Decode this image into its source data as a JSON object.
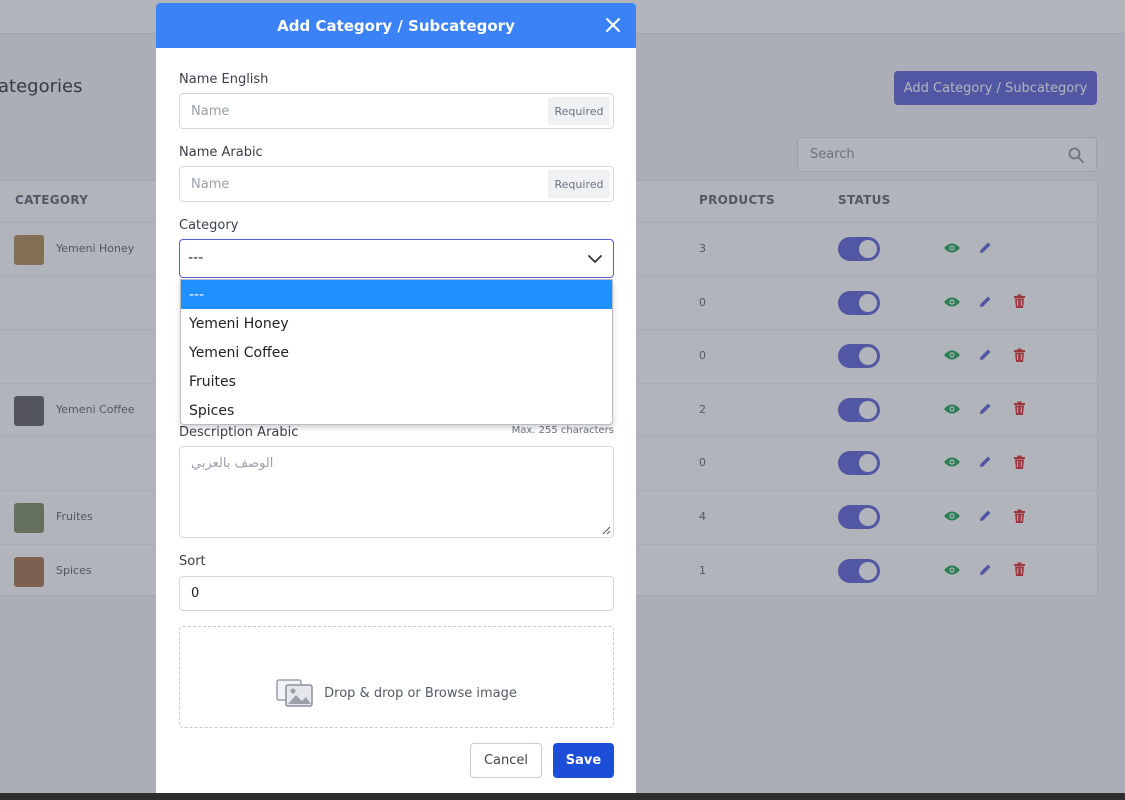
{
  "background": {
    "page_title": "ategories",
    "add_button": "Add Category / Subcategory",
    "search_placeholder": "Search",
    "table": {
      "headers": {
        "category": "CATEGORY",
        "products": "PRODUCTS",
        "status": "STATUS"
      },
      "rows": [
        {
          "name": "Yemeni Honey",
          "products": "3",
          "thumb_color": "#b0894f",
          "has_thumb": true,
          "has_delete": false
        },
        {
          "name": "",
          "products": "0",
          "has_thumb": false,
          "has_delete": true
        },
        {
          "name": "",
          "products": "0",
          "has_thumb": false,
          "has_delete": true
        },
        {
          "name": "Yemeni Coffee",
          "products": "2",
          "thumb_color": "#5e5a5e",
          "has_thumb": true,
          "has_delete": true
        },
        {
          "name": "",
          "products": "0",
          "has_thumb": false,
          "has_delete": true
        },
        {
          "name": "Fruites",
          "products": "4",
          "thumb_color": "#7a8a5a",
          "has_thumb": true,
          "has_delete": true
        },
        {
          "name": "Spices",
          "products": "1",
          "thumb_color": "#a07048",
          "has_thumb": true,
          "has_delete": true
        }
      ]
    }
  },
  "modal": {
    "title": "Add Category / Subcategory",
    "name_english": {
      "label": "Name English",
      "placeholder": "Name",
      "badge": "Required"
    },
    "name_arabic": {
      "label": "Name Arabic",
      "placeholder": "Name",
      "badge": "Required"
    },
    "category": {
      "label": "Category",
      "value": "---",
      "options": [
        "---",
        "Yemeni Honey",
        "Yemeni Coffee",
        "Fruites",
        "Spices"
      ],
      "selected_index": 0
    },
    "description_arabic": {
      "label": "Description Arabic",
      "hint": "Max. 255 characters",
      "placeholder": "الوصف بالعربي"
    },
    "sort": {
      "label": "Sort",
      "value": "0"
    },
    "dropzone_text": "Drop & drop or Browse image",
    "cancel_label": "Cancel",
    "save_label": "Save"
  },
  "colors": {
    "header_blue": "#3b82f6",
    "accent_indigo": "#5c60d8",
    "save_blue": "#1d4ed8",
    "option_highlight": "#1e90ff",
    "eye_green": "#16a34a",
    "delete_red": "#dc2626"
  },
  "icons": {
    "close": "close-icon",
    "chevron": "chevron-down-icon",
    "image": "image-icon",
    "search": "search-icon",
    "view": "eye-icon",
    "edit": "pencil-icon",
    "delete": "trash-icon"
  }
}
